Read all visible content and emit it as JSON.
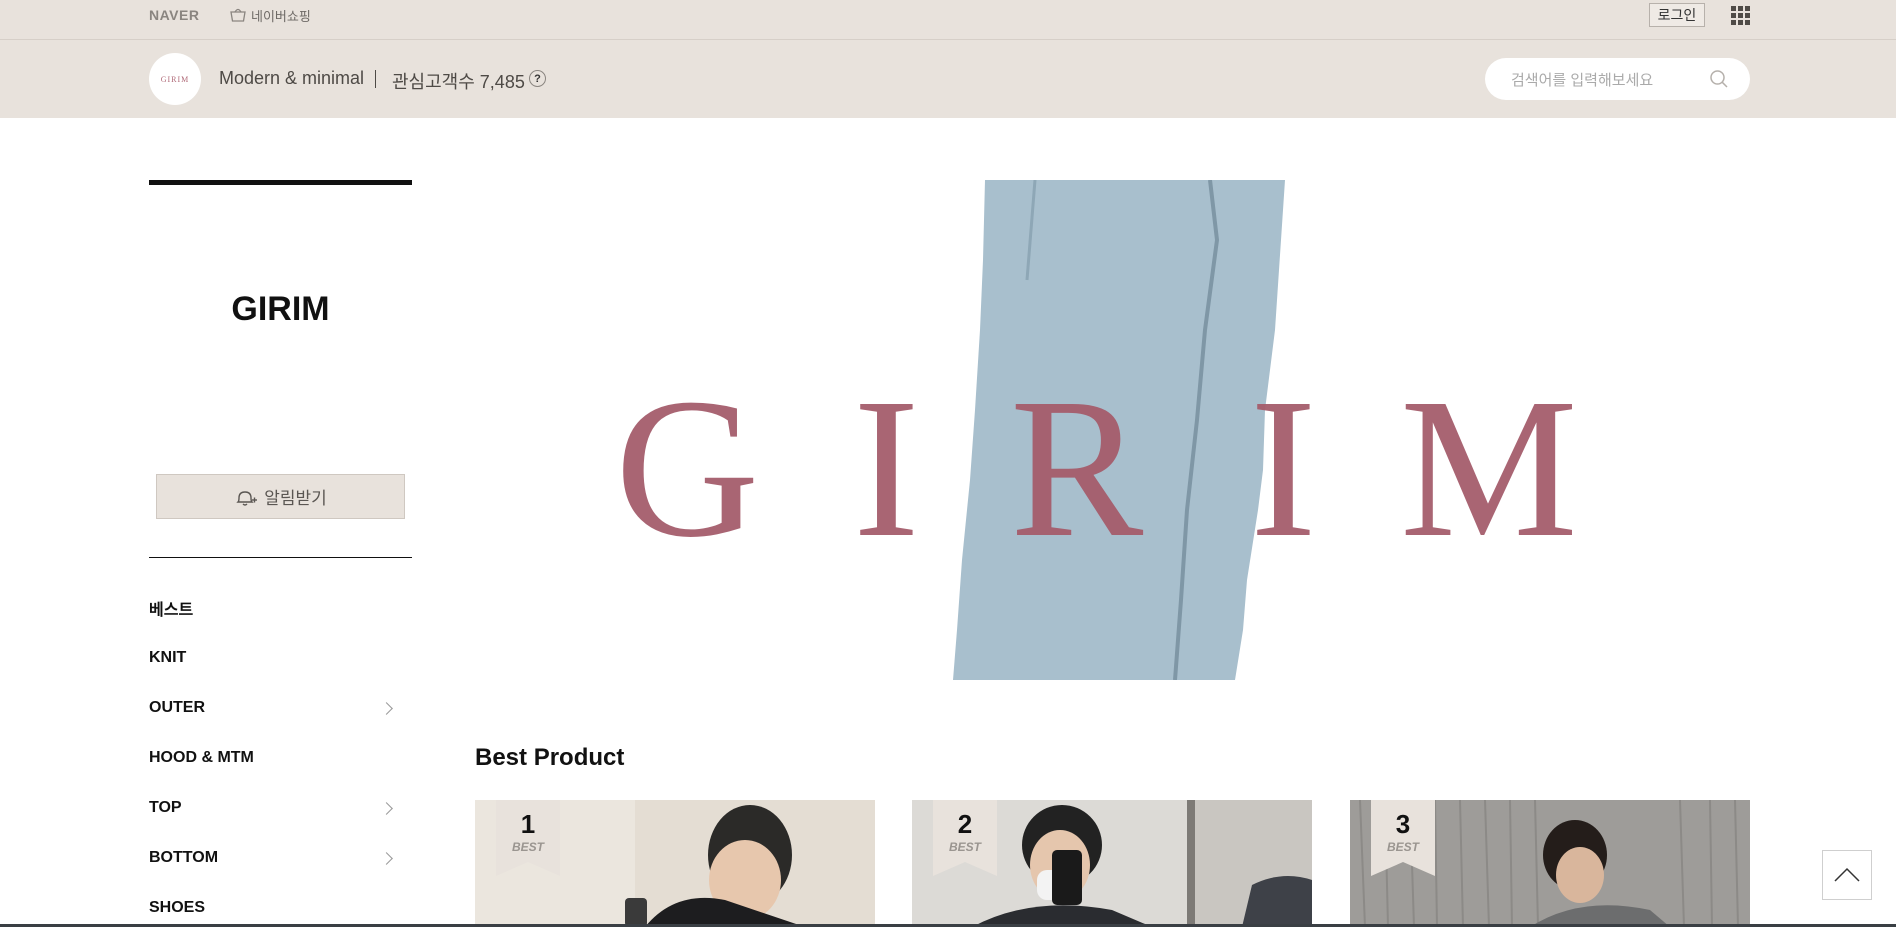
{
  "topbar": {
    "naver_logo": "NAVER",
    "shopping_link": "네이버쇼핑",
    "login_button": "로그인",
    "apps_icon": "grid-apps-icon"
  },
  "store": {
    "avatar_text": "GIRIM",
    "tagline": "Modern & minimal",
    "followers_text": "관심고객수 7,485",
    "help_icon_text": "?",
    "search_placeholder": "검색어를 입력해보세요",
    "search_value": ""
  },
  "sidebar": {
    "brand": "GIRIM",
    "notify_button": "알림받기",
    "categories": [
      {
        "label": "베스트",
        "has_submenu": false
      },
      {
        "label": "KNIT",
        "has_submenu": false
      },
      {
        "label": "OUTER",
        "has_submenu": true
      },
      {
        "label": "HOOD & MTM",
        "has_submenu": false
      },
      {
        "label": "TOP",
        "has_submenu": true
      },
      {
        "label": "BOTTOM",
        "has_submenu": true
      },
      {
        "label": "SHOES",
        "has_submenu": false
      }
    ]
  },
  "banner": {
    "text_letters": [
      "G",
      "I",
      "R",
      "I",
      "M"
    ],
    "text_color": "#a55d6c",
    "stroke_color": "#a8bfcd"
  },
  "best_products": {
    "title": "Best Product",
    "items": [
      {
        "rank": "1",
        "badge": "BEST"
      },
      {
        "rank": "2",
        "badge": "BEST"
      },
      {
        "rank": "3",
        "badge": "BEST"
      }
    ]
  },
  "colors": {
    "header_bg": "#e8e2dc",
    "accent_rose": "#a55d6c"
  }
}
